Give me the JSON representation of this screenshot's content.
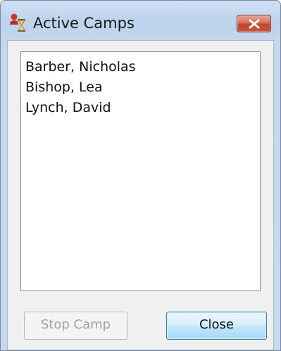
{
  "window": {
    "title": "Active Camps",
    "app_icon": "user-hourglass-icon",
    "close_icon": "close-icon"
  },
  "camps": [
    "Barber, Nicholas",
    "Bishop, Lea",
    "Lynch, David"
  ],
  "buttons": {
    "stop_label": "Stop Camp",
    "stop_enabled": false,
    "close_label": "Close"
  },
  "colors": {
    "titlebar": "#c4d8ee",
    "close_button": "#c9553a",
    "focused_button_border": "#3c7fb1"
  }
}
